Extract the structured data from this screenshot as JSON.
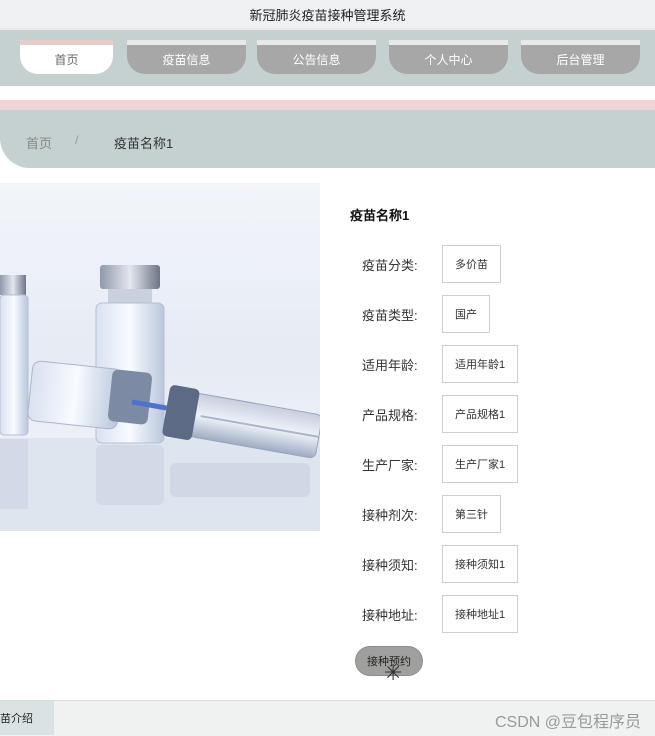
{
  "app": {
    "title": "新冠肺炎疫苗接种管理系统"
  },
  "nav": {
    "tabs": [
      {
        "label": "首页",
        "active": true
      },
      {
        "label": "疫苗信息",
        "active": false
      },
      {
        "label": "公告信息",
        "active": false
      },
      {
        "label": "个人中心",
        "active": false
      },
      {
        "label": "后台管理",
        "active": false
      }
    ]
  },
  "breadcrumb": {
    "home": "首页",
    "separator": "/",
    "current": "疫苗名称1"
  },
  "vaccine": {
    "name": "疫苗名称1",
    "fields": [
      {
        "label": "疫苗分类:",
        "value": "多价苗"
      },
      {
        "label": "疫苗类型:",
        "value": "国产"
      },
      {
        "label": "适用年龄:",
        "value": "适用年龄1"
      },
      {
        "label": "产品规格:",
        "value": "产品规格1"
      },
      {
        "label": "生产厂家:",
        "value": "生产厂家1"
      },
      {
        "label": "接种剂次:",
        "value": "第三针"
      },
      {
        "label": "接种须知:",
        "value": "接种须知1"
      },
      {
        "label": "接种地址:",
        "value": "接种地址1"
      }
    ],
    "book_button": "接种预约"
  },
  "bottom": {
    "tab_label": "疫苗介绍"
  },
  "watermark": "CSDN @豆包程序员",
  "colors": {
    "nav_bg": "#c5d0d1",
    "tab_bg": "#a7a7a7",
    "pink": "#eed6d6"
  }
}
